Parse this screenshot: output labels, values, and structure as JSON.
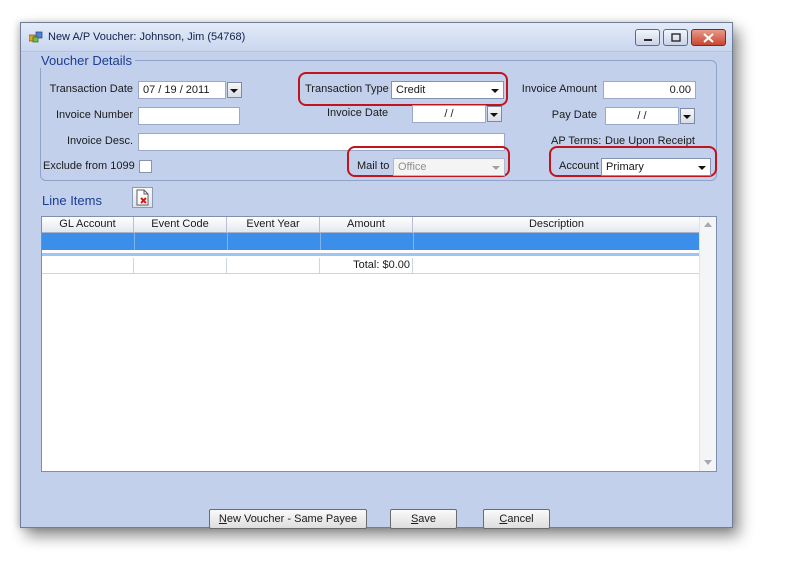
{
  "window": {
    "title": "New A/P Voucher: Johnson, Jim (54768)",
    "controls": [
      "minimize-icon",
      "maximize-icon",
      "close-icon"
    ]
  },
  "voucher_details": {
    "group_title": "Voucher Details",
    "transaction_date_label": "Transaction Date",
    "transaction_date_value": "07 / 19 / 2011",
    "transaction_type_label": "Transaction Type",
    "transaction_type_value": "Credit",
    "invoice_amount_label": "Invoice Amount",
    "invoice_amount_value": "0.00",
    "invoice_number_label": "Invoice Number",
    "invoice_number_value": "",
    "invoice_date_label": "Invoice Date",
    "invoice_date_value": "/     /",
    "pay_date_label": "Pay Date",
    "pay_date_value": "/     /",
    "invoice_desc_label": "Invoice Desc.",
    "invoice_desc_value": "",
    "ap_terms_label": "AP Terms:",
    "ap_terms_value": "Due Upon Receipt",
    "exclude_1099_label": "Exclude from 1099",
    "exclude_1099_checked": false,
    "mail_to_label": "Mail to",
    "mail_to_value": "Office",
    "account_label": "Account",
    "account_value": "Primary"
  },
  "line_items": {
    "title": "Line Items",
    "delete_icon": "delete-document-icon",
    "columns": [
      "GL Account",
      "Event Code",
      "Event Year",
      "Amount",
      "Description"
    ],
    "total_label": "Total: $0.00"
  },
  "buttons": {
    "new_voucher_hotkey": "N",
    "new_voucher_rest": "ew Voucher - Same Payee",
    "save_hotkey": "S",
    "save_rest": "ave",
    "cancel_hotkey": "C",
    "cancel_rest": "ancel"
  },
  "colors": {
    "highlight": "#c1141c",
    "selected_row": "#3b8eea",
    "group_title": "#1a3d94"
  }
}
